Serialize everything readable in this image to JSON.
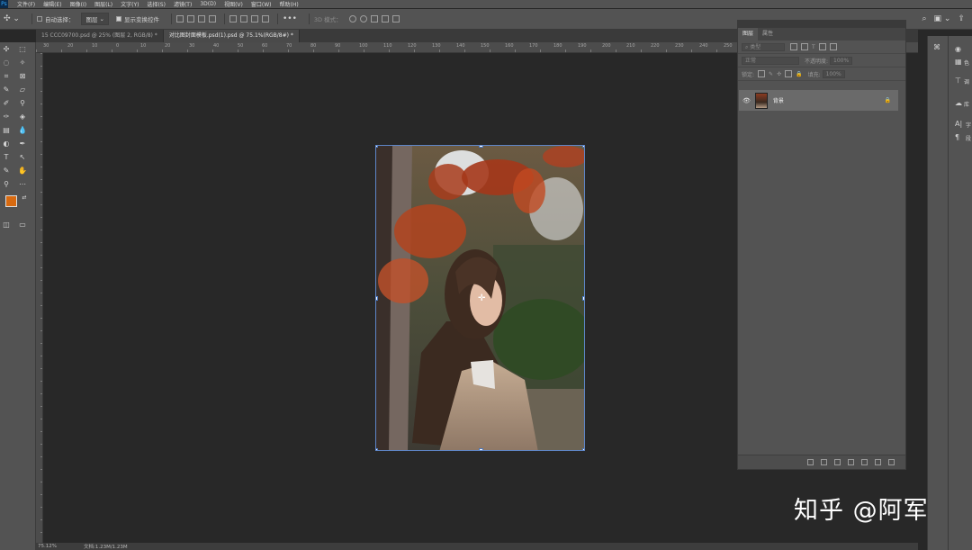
{
  "menubar": {
    "app_icon": "Ps",
    "items": [
      "文件(F)",
      "编辑(E)",
      "图像(I)",
      "图层(L)",
      "文字(Y)",
      "选择(S)",
      "滤镜(T)",
      "3D(D)",
      "视图(V)",
      "窗口(W)",
      "帮助(H)"
    ]
  },
  "options": {
    "auto_select_label": "自动选择：",
    "auto_select_target": "图层",
    "show_transform_label": "显示变换控件",
    "mode_3d_label": "3D 模式："
  },
  "tabs": [
    {
      "label": "15 CCC09700.psd @ 25% (图层 2, RGB/8) *",
      "active": false
    },
    {
      "label": "对比图封面模板.psd(1).psd @ 75.1%(RGB/8#) *",
      "active": true
    }
  ],
  "ruler": {
    "ticks": [
      "30",
      "20",
      "10",
      "0",
      "10",
      "20",
      "30",
      "40",
      "50",
      "60",
      "70",
      "80",
      "90",
      "100",
      "110",
      "120",
      "130",
      "140",
      "150",
      "160",
      "170",
      "180",
      "190",
      "200",
      "210",
      "220",
      "230",
      "240",
      "250",
      "260",
      "270",
      "280",
      "290",
      "300",
      "310",
      "320"
    ]
  },
  "status": {
    "zoom": "75.12%",
    "doc": "文档:1.23M/1.23M"
  },
  "layers_panel": {
    "tab_layers": "图层",
    "tab_properties": "属性",
    "filter_placeholder": "类型",
    "blend_mode": "正常",
    "opacity_label": "不透明度:",
    "opacity_value": "100%",
    "lock_label": "锁定:",
    "fill_label": "填充:",
    "fill_value": "100%",
    "layer_name": "背景"
  },
  "right_dock": {
    "items": [
      "色",
      "调",
      "库",
      "字",
      "段"
    ]
  },
  "watermark": "知乎 @阿军",
  "colors": {
    "foreground": "#d86a10",
    "background": "#000000",
    "selection": "#5e86c8"
  }
}
